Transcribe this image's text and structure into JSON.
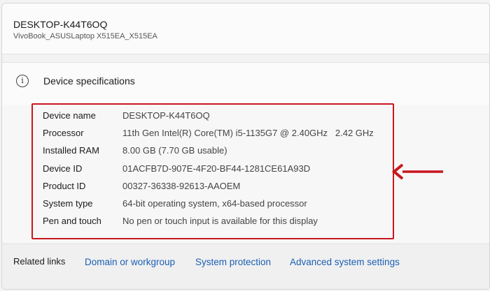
{
  "device": {
    "name": "DESKTOP-K44T6OQ",
    "model": "VivoBook_ASUSLaptop X515EA_X515EA"
  },
  "specs": {
    "title": "Device specifications",
    "icon": "info-icon",
    "rows": [
      {
        "label": "Device name",
        "value": "DESKTOP-K44T6OQ"
      },
      {
        "label": "Processor",
        "value": "11th Gen Intel(R) Core(TM) i5-1135G7 @ 2.40GHz   2.42 GHz"
      },
      {
        "label": "Installed RAM",
        "value": "8.00 GB (7.70 GB usable)"
      },
      {
        "label": "Device ID",
        "value": "01ACFB7D-907E-4F20-BF44-1281CE61A93D"
      },
      {
        "label": "Product ID",
        "value": "00327-36338-92613-AAOEM"
      },
      {
        "label": "System type",
        "value": "64-bit operating system, x64-based processor"
      },
      {
        "label": "Pen and touch",
        "value": "No pen or touch input is available for this display"
      }
    ]
  },
  "related": {
    "label": "Related links",
    "links": [
      "Domain or workgroup",
      "System protection",
      "Advanced system settings"
    ]
  },
  "colors": {
    "highlight": "#c9171e",
    "link": "#1a5fb4"
  }
}
